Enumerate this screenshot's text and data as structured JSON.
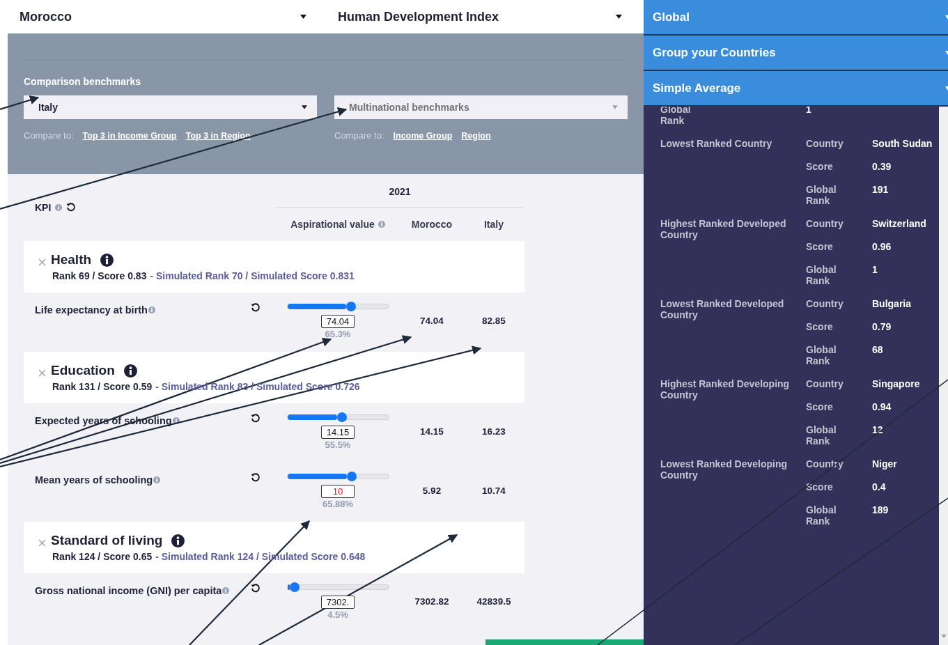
{
  "country_select": {
    "value": "Morocco"
  },
  "index_select": {
    "value": "Human Development Index"
  },
  "benchmarks": {
    "title": "Comparison benchmarks",
    "country_select": {
      "value": "Italy"
    },
    "multinational_select": {
      "placeholder": "Multinational benchmarks"
    },
    "compare_country": {
      "label": "Compare to:",
      "links": [
        "Top 3 in Income Group",
        "Top 3 in Region"
      ]
    },
    "compare_multinational": {
      "label": "Compare to:",
      "links": [
        "Income Group",
        "Region"
      ]
    }
  },
  "table": {
    "kpi_label": "KPI",
    "year": "2021",
    "columns": [
      "Aspirational value",
      "Morocco",
      "Italy"
    ],
    "groups": [
      {
        "name": "Health",
        "summary": "Rank 69 / Score 0.83",
        "simulated": "- Simulated Rank 70 / Simulated Score 0.831",
        "indicators": [
          {
            "name": "Life expectancy at birth",
            "level": 0.63,
            "value": "74.04",
            "invalid": false,
            "percent": "65.3%",
            "country_value": "74.04",
            "benchmark_value": "82.85"
          }
        ]
      },
      {
        "name": "Education",
        "summary": "Rank 131 / Score 0.59",
        "simulated": "- Simulated Rank 83 / Simulated Score 0.726",
        "indicators": [
          {
            "name": "Expected years of schooling",
            "level": 0.54,
            "value": "14.15",
            "invalid": false,
            "percent": "55.5%",
            "country_value": "14.15",
            "benchmark_value": "16.23"
          },
          {
            "name": "Mean years of schooling",
            "level": 0.64,
            "value": "10",
            "invalid": true,
            "percent": "65.88%",
            "country_value": "5.92",
            "benchmark_value": "10.74"
          }
        ]
      },
      {
        "name": "Standard of living",
        "summary": "Rank 124 / Score 0.65",
        "simulated": "- Simulated Rank 124 / Simulated Score 0.648",
        "indicators": [
          {
            "name": "Gross national income (GNI) per capita",
            "level": 0.07,
            "value": "7302.",
            "invalid": false,
            "percent": "4.5%",
            "country_value": "7302.82",
            "benchmark_value": "42839.5"
          }
        ]
      }
    ]
  },
  "sidebar": {
    "sections": [
      {
        "title": "Global"
      },
      {
        "title": "Group your Countries"
      },
      {
        "title": "Simple Average"
      }
    ],
    "stats": [
      {
        "rows": [
          {
            "key": "Global Rank",
            "value": "1"
          }
        ]
      },
      {
        "label": "Lowest Ranked Country",
        "rows": [
          {
            "key": "Country",
            "value": "South Sudan"
          },
          {
            "key": "Score",
            "value": "0.39"
          },
          {
            "key": "Global Rank",
            "value": "191"
          }
        ]
      },
      {
        "label": "Highest Ranked Developed Country",
        "rows": [
          {
            "key": "Country",
            "value": "Switzerland"
          },
          {
            "key": "Score",
            "value": "0.96"
          },
          {
            "key": "Global Rank",
            "value": "1"
          }
        ]
      },
      {
        "label": "Lowest Ranked Developed Country",
        "rows": [
          {
            "key": "Country",
            "value": "Bulgaria"
          },
          {
            "key": "Score",
            "value": "0.79"
          },
          {
            "key": "Global Rank",
            "value": "68"
          }
        ]
      },
      {
        "label": "Highest Ranked Developing Country",
        "rows": [
          {
            "key": "Country",
            "value": "Singapore"
          },
          {
            "key": "Score",
            "value": "0.94"
          },
          {
            "key": "Global Rank",
            "value": "12"
          }
        ]
      },
      {
        "label": "Lowest Ranked Developing Country",
        "rows": [
          {
            "key": "Country",
            "value": "Niger"
          },
          {
            "key": "Score",
            "value": "0.4"
          },
          {
            "key": "Global Rank",
            "value": "189"
          }
        ]
      }
    ]
  }
}
